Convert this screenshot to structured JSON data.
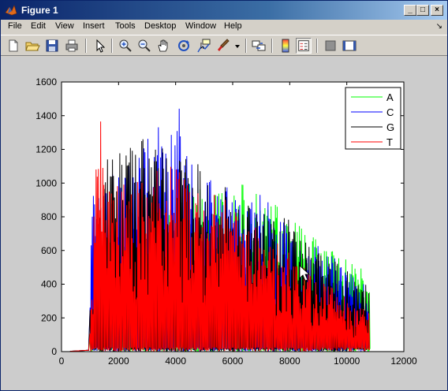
{
  "window": {
    "title": "Figure 1"
  },
  "title_buttons": {
    "minimize": "_",
    "maximize": "□",
    "close": "×"
  },
  "menu": {
    "items": [
      "File",
      "Edit",
      "View",
      "Insert",
      "Tools",
      "Desktop",
      "Window",
      "Help"
    ],
    "dock_arrow": "↘"
  },
  "toolbar": {
    "buttons": [
      "new-figure",
      "open-file",
      "save",
      "print",
      "edit-plot",
      "zoom-in",
      "zoom-out",
      "pan",
      "rotate-3d",
      "data-cursor",
      "brush",
      "link-plot",
      "colorbar",
      "legend",
      "hide-plot-tools",
      "show-plot-tools"
    ]
  },
  "colors": {
    "A": "#00ff00",
    "C": "#0000ff",
    "G": "#000000",
    "T": "#ff0000"
  },
  "chart_data": {
    "type": "line",
    "title": "",
    "xlabel": "",
    "ylabel": "",
    "xlim": [
      0,
      12000
    ],
    "ylim": [
      0,
      1600
    ],
    "x_ticks": [
      "0",
      "2000",
      "4000",
      "6000",
      "8000",
      "10000",
      "12000"
    ],
    "y_ticks": [
      "0",
      "200",
      "400",
      "600",
      "800",
      "1000",
      "1200",
      "1400",
      "1600"
    ],
    "legend": {
      "position": "top-right",
      "entries": [
        "A",
        "C",
        "G",
        "T"
      ]
    },
    "series": [
      {
        "name": "A",
        "color": "#00ff00",
        "x": [
          1000,
          1500,
          2000,
          2500,
          3000,
          3500,
          4000,
          4500,
          5000,
          5500,
          6000,
          6500,
          7000,
          7500,
          8000,
          8500,
          9000,
          9500,
          10000,
          10500,
          10800
        ],
        "values": [
          100,
          650,
          700,
          850,
          900,
          800,
          900,
          1050,
          950,
          950,
          1000,
          1000,
          920,
          880,
          880,
          750,
          650,
          600,
          550,
          500,
          350
        ]
      },
      {
        "name": "C",
        "color": "#0000ff",
        "x": [
          1000,
          1100,
          1500,
          2000,
          2500,
          3000,
          3500,
          4000,
          4100,
          4500,
          5000,
          5500,
          6000,
          6500,
          7000,
          7500,
          8000,
          8500,
          9000,
          9500,
          10000,
          10500,
          10800
        ],
        "values": [
          300,
          1310,
          1000,
          1100,
          1150,
          1260,
          1350,
          1300,
          1470,
          1200,
          1050,
          1050,
          1000,
          900,
          950,
          850,
          800,
          700,
          650,
          580,
          520,
          420,
          390
        ]
      },
      {
        "name": "G",
        "color": "#000000",
        "x": [
          1000,
          1500,
          2000,
          2500,
          3000,
          3500,
          4000,
          4500,
          5000,
          5500,
          6000,
          6500,
          7000,
          7500,
          8000,
          8500,
          9000,
          9500,
          10000,
          10500,
          10800
        ],
        "values": [
          250,
          1150,
          1200,
          1250,
          1270,
          1250,
          1150,
          1200,
          1100,
          1000,
          950,
          880,
          850,
          830,
          800,
          700,
          620,
          560,
          480,
          420,
          380
        ]
      },
      {
        "name": "T",
        "color": "#ff0000",
        "x": [
          1000,
          1300,
          1500,
          2000,
          2500,
          3000,
          3500,
          4000,
          4500,
          5000,
          5500,
          6000,
          6500,
          7000,
          7500,
          8000,
          8500,
          9000,
          9500,
          10000,
          10500,
          10800
        ],
        "values": [
          200,
          1600,
          950,
          1050,
          1100,
          1050,
          1100,
          1150,
          1000,
          950,
          950,
          850,
          800,
          700,
          650,
          600,
          500,
          420,
          380,
          320,
          260,
          240
        ]
      }
    ]
  }
}
